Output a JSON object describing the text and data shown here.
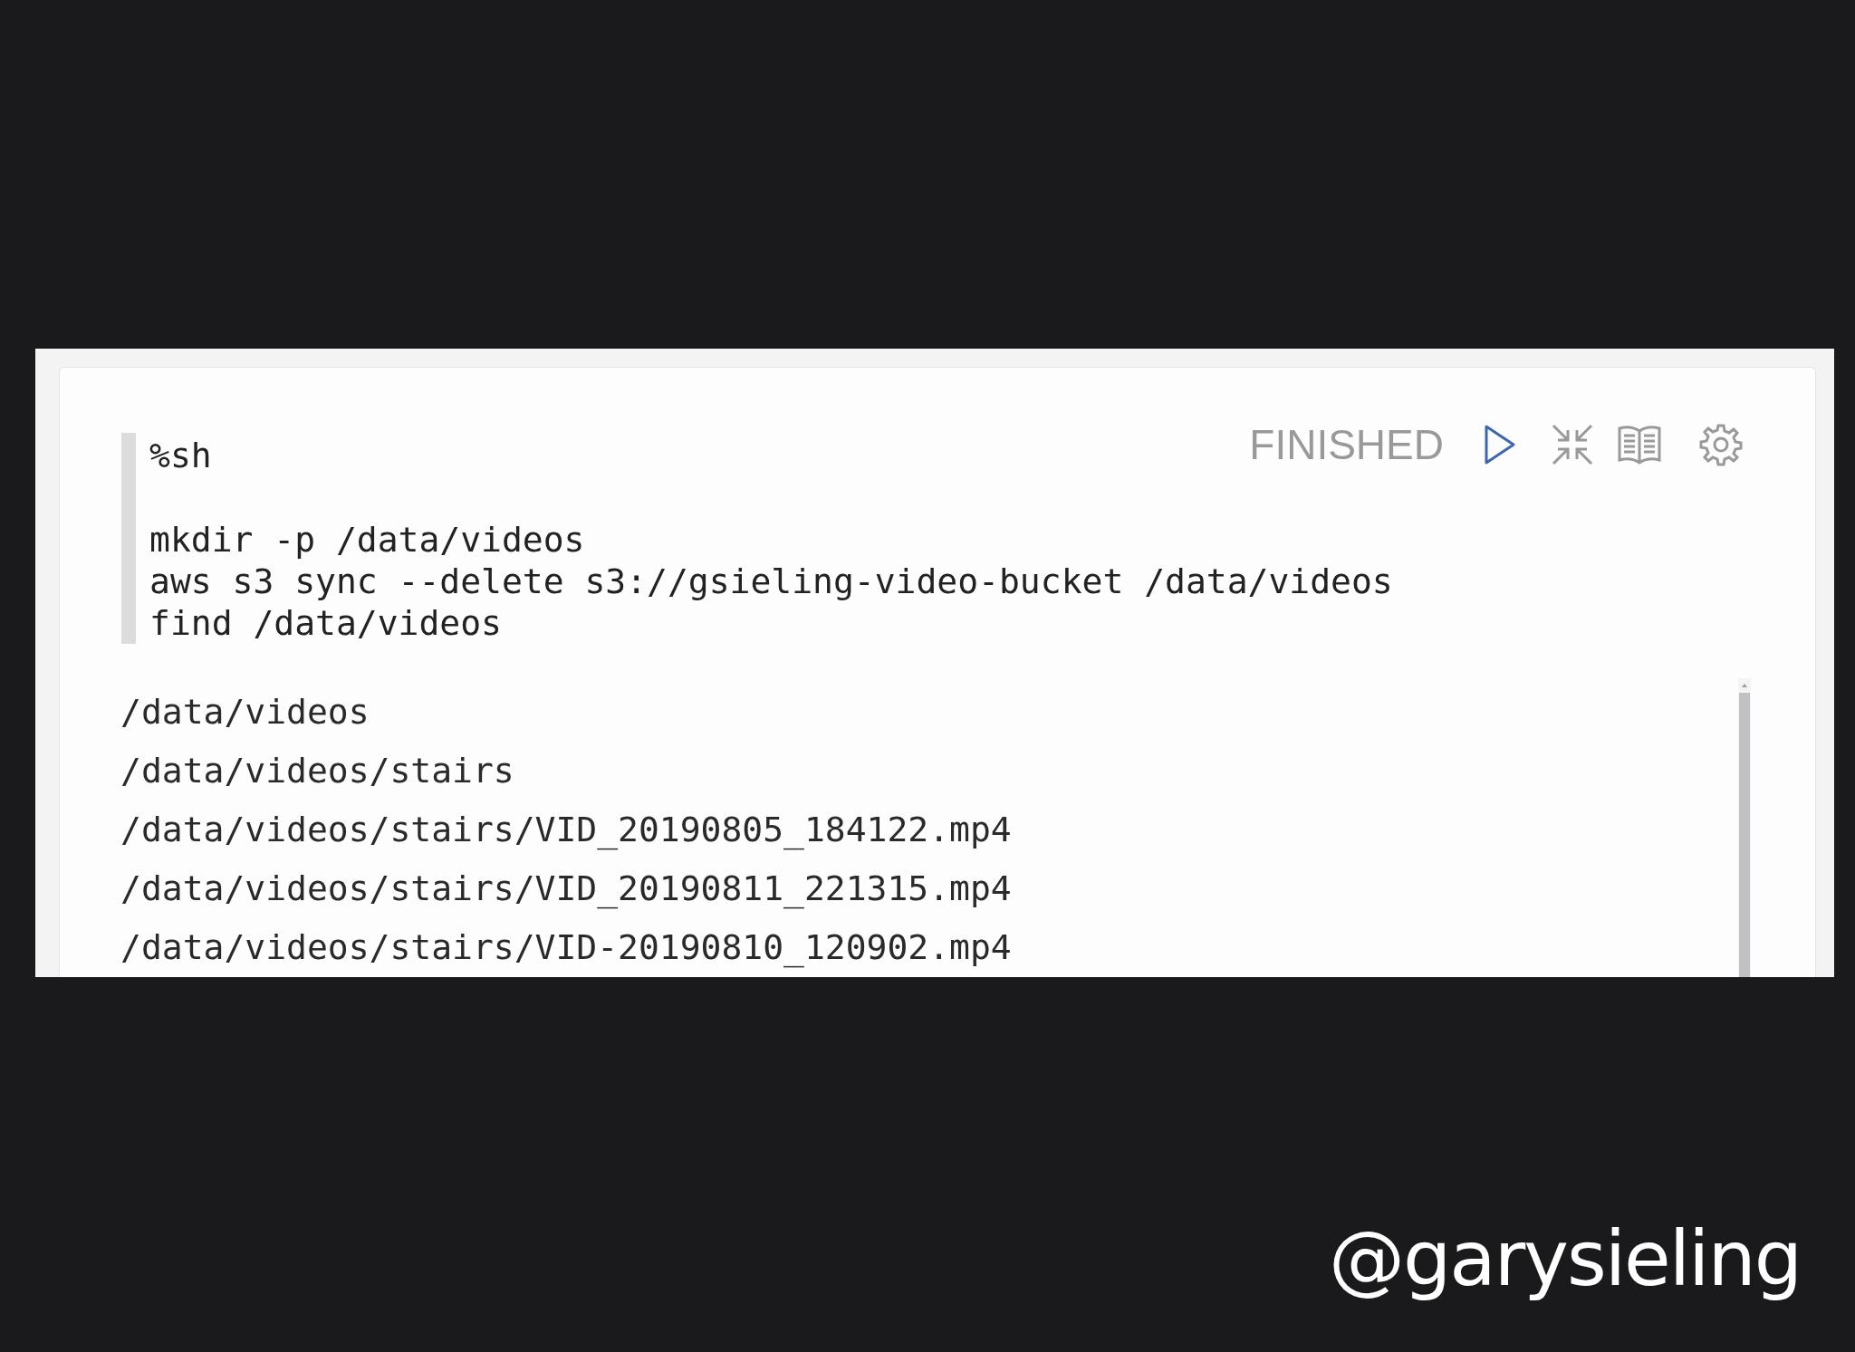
{
  "paragraph": {
    "status": "FINISHED",
    "editor": {
      "interpreter": "%sh",
      "lines": [
        "mkdir -p /data/videos",
        "aws s3 sync --delete s3://gsieling-video-bucket /data/videos",
        "find /data/videos"
      ]
    },
    "output": [
      "/data/videos",
      "/data/videos/stairs",
      "/data/videos/stairs/VID_20190805_184122.mp4",
      "/data/videos/stairs/VID_20190811_221315.mp4",
      "/data/videos/stairs/VID-20190810_120902.mp4"
    ]
  },
  "caption": "@garysieling"
}
